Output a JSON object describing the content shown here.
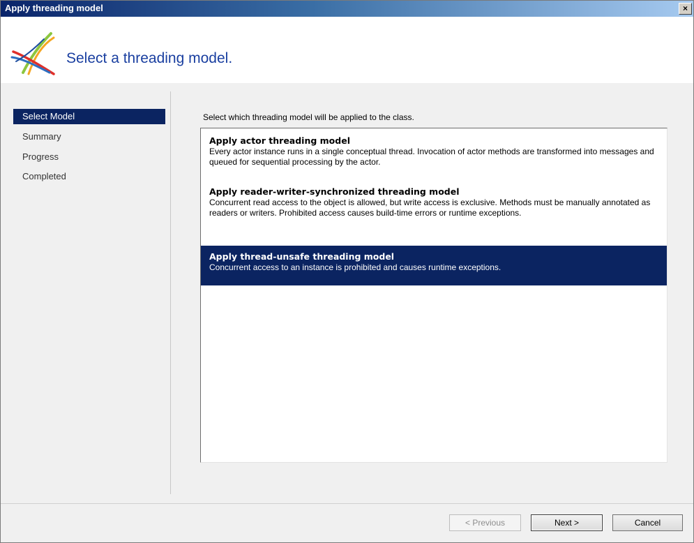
{
  "window": {
    "title": "Apply threading model",
    "close_glyph": "×"
  },
  "header": {
    "title": "Select a threading model.",
    "logo_icon": "threading-wizard-logo"
  },
  "nav": {
    "items": [
      {
        "label": "Select Model",
        "selected": true
      },
      {
        "label": "Summary",
        "selected": false
      },
      {
        "label": "Progress",
        "selected": false
      },
      {
        "label": "Completed",
        "selected": false
      }
    ]
  },
  "main": {
    "instruction": "Select which threading model will be applied to the class.",
    "options": [
      {
        "title": "Apply actor threading model",
        "description": "Every actor instance runs in a single conceptual thread. Invocation of actor methods are transformed into messages and queued for sequential processing by the actor.",
        "selected": false
      },
      {
        "title": "Apply reader-writer-synchronized threading model",
        "description": "Concurrent read access to the object is allowed, but write access is exclusive. Methods must be manually annotated as readers or writers. Prohibited access causes build-time errors or runtime exceptions.",
        "selected": false
      },
      {
        "title": "Apply thread-unsafe threading model",
        "description": "Concurrent access to an instance is prohibited and causes runtime exceptions.",
        "selected": true
      }
    ]
  },
  "footer": {
    "previous_label": "< Previous",
    "next_label": "Next >",
    "cancel_label": "Cancel",
    "previous_enabled": false
  },
  "colors": {
    "selection": "#0b2461",
    "header_text": "#1a3fa0",
    "title_gradient_start": "#0a246a",
    "title_gradient_end": "#a6caf0"
  }
}
